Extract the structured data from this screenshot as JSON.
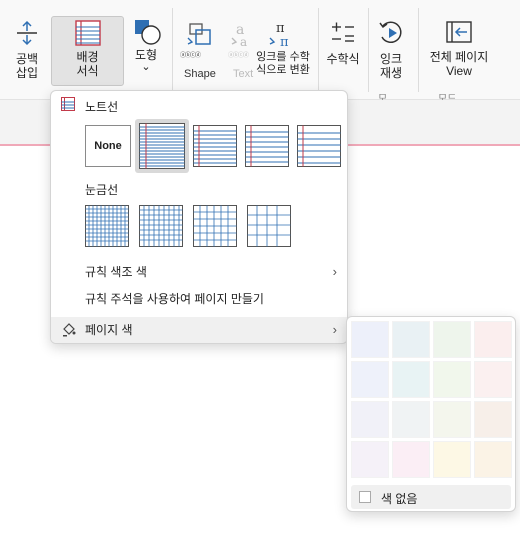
{
  "ribbon": {
    "insert_space": [
      "공백",
      "삽입"
    ],
    "background": [
      "배경",
      "서식"
    ],
    "shapes": "도형",
    "shapes_chevron": "⌄",
    "shape_group": "Shape",
    "text_group": "Text",
    "ink_to_shape_small": "ⓐⓑⓒⓓ",
    "ink_to_text_small": "ⓐⓑⓒⓓ",
    "math_convert": "잉크를 수학 식으로 변환",
    "math": "수학식",
    "ink_replay": [
      "잉크",
      "재생"
    ],
    "full_page": [
      "전체 페이지",
      "View"
    ],
    "group_labels": [
      "모",
      "모드"
    ]
  },
  "menu": {
    "section_note_lines": "노트선",
    "none_label": "None",
    "section_grid": "눈금선",
    "rule_color": "규칙 색조 색",
    "create_with_rule": "규칙 주석을 사용하여 페이지 만들기",
    "page_color": "페이지 색",
    "chevron": "›"
  },
  "submenu": {
    "no_color": "색 없음",
    "swatches": [
      "#edf0fa",
      "#e9f1f4",
      "#eef5ec",
      "#fbeeee",
      "#eef1fa",
      "#e8f3f4",
      "#f1f7ec",
      "#fbf0f0",
      "#f1f1f8",
      "#f0f3f4",
      "#f4f6ed",
      "#f7efe9",
      "#f5f1f8",
      "#fbeef5",
      "#fdf8e5",
      "#fbf3e6"
    ]
  }
}
